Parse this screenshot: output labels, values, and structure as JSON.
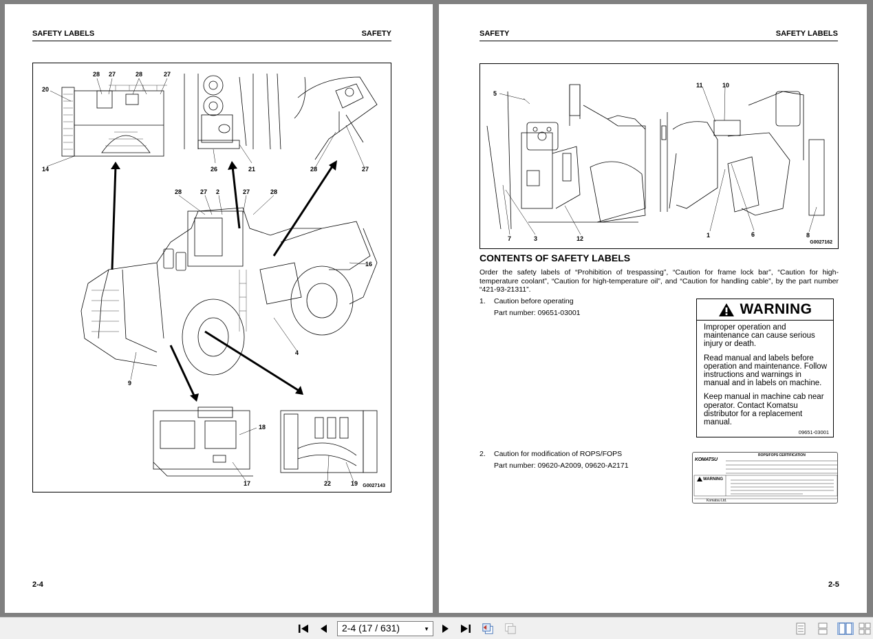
{
  "left_page": {
    "header_left": "SAFETY LABELS",
    "header_right": "SAFETY",
    "figure_code": "G0027143",
    "page_number": "2-4",
    "callouts": [
      "28",
      "27",
      "28",
      "27",
      "20",
      "14",
      "26",
      "21",
      "28",
      "27",
      "28",
      "27",
      "2",
      "27",
      "28",
      "16",
      "4",
      "9",
      "18",
      "17",
      "22",
      "19"
    ]
  },
  "right_page": {
    "header_left": "SAFETY",
    "header_right": "SAFETY LABELS",
    "figure_code": "G0027162",
    "callouts": [
      "5",
      "11",
      "10",
      "7",
      "3",
      "12",
      "1",
      "6",
      "8"
    ],
    "section_title": "CONTENTS OF SAFETY LABELS",
    "intro": "Order the safety labels of “Prohibition of trespassing”, “Caution for frame lock bar”, “Caution for high-temperature coolant”, “Caution for high-temperature oil”, and “Caution for handling cable”, by the part number “421-93-21311”.",
    "items": [
      {
        "number": "1.",
        "title": "Caution before operating",
        "part": "Part number: 09651-03001"
      },
      {
        "number": "2.",
        "title": "Caution for modification of ROPS/FOPS",
        "part": "Part number: 09620-A2009, 09620-A2171"
      }
    ],
    "warning_label": {
      "heading": "WARNING",
      "paragraphs": [
        "Improper operation and maintenance can cause serious injury or death.",
        "Read manual and labels before operation and maintenance. Follow instructions and warnings in manual and in labels on machine.",
        "Keep manual in machine cab near operator. Contact Komatsu distributor for a replacement manual."
      ],
      "code": "09651-03001"
    },
    "rops_label": {
      "brand": "KOMATSU",
      "title": "ROPS/FOPS CERTIFICATION",
      "warning": "WARNING",
      "footer": "Komatsu Ltd."
    },
    "page_number": "2-5"
  },
  "toolbar": {
    "page_select": "2-4 (17 / 631)"
  }
}
